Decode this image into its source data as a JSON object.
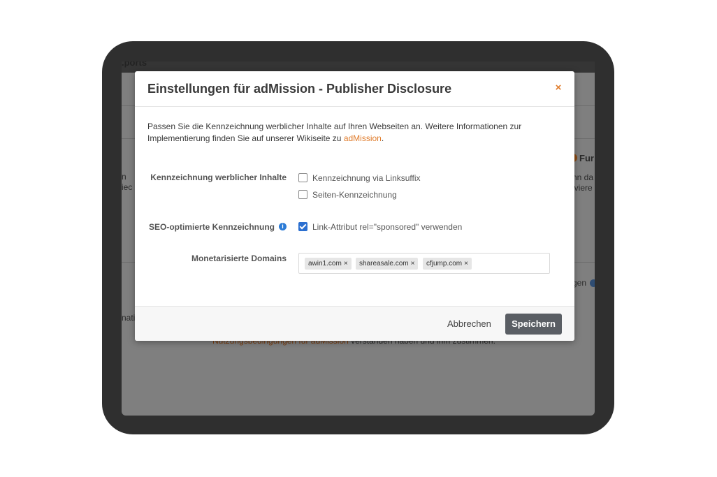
{
  "background": {
    "header_fragment": ".ports",
    "left_fragments": [
      "n",
      "iec",
      "nati"
    ],
    "right_fragments": [
      "Fur",
      "nn da",
      "iviere",
      "gen"
    ],
    "bottom_link_fragment": "Nutzungsbedingungen für adMission",
    "bottom_text_fragment": " verstanden haben und ihm zustimmen."
  },
  "modal": {
    "title": "Einstellungen für adMission - Publisher Disclosure",
    "close_label": "×",
    "intro_text": "Passen Sie die Kennzeichnung werblicher Inhalte auf Ihren Webseiten an. Weitere Informationen zur Implementierung finden Sie auf unserer Wikiseite zu ",
    "intro_link": "adMission",
    "intro_end": ".",
    "fields": {
      "labeling": {
        "label": "Kennzeichnung werblicher Inhalte",
        "options": [
          {
            "label": "Kennzeichnung via Linksuffix",
            "checked": false
          },
          {
            "label": "Seiten-Kennzeichnung",
            "checked": false
          }
        ]
      },
      "seo": {
        "label": "SEO-optimierte Kennzeichnung",
        "info_icon": "i",
        "option": {
          "label": "Link-Attribut rel=\"sponsored\" verwenden",
          "checked": true
        }
      },
      "domains": {
        "label": "Monetarisierte Domains",
        "tags": [
          "awin1.com",
          "shareasale.com",
          "cfjump.com"
        ],
        "remove_glyph": "×"
      }
    },
    "footer": {
      "cancel_label": "Abbrechen",
      "save_label": "Speichern"
    }
  },
  "colors": {
    "accent": "#e07b2a",
    "checkbox_checked": "#2b6fd0",
    "save_button": "#5a5e64"
  }
}
